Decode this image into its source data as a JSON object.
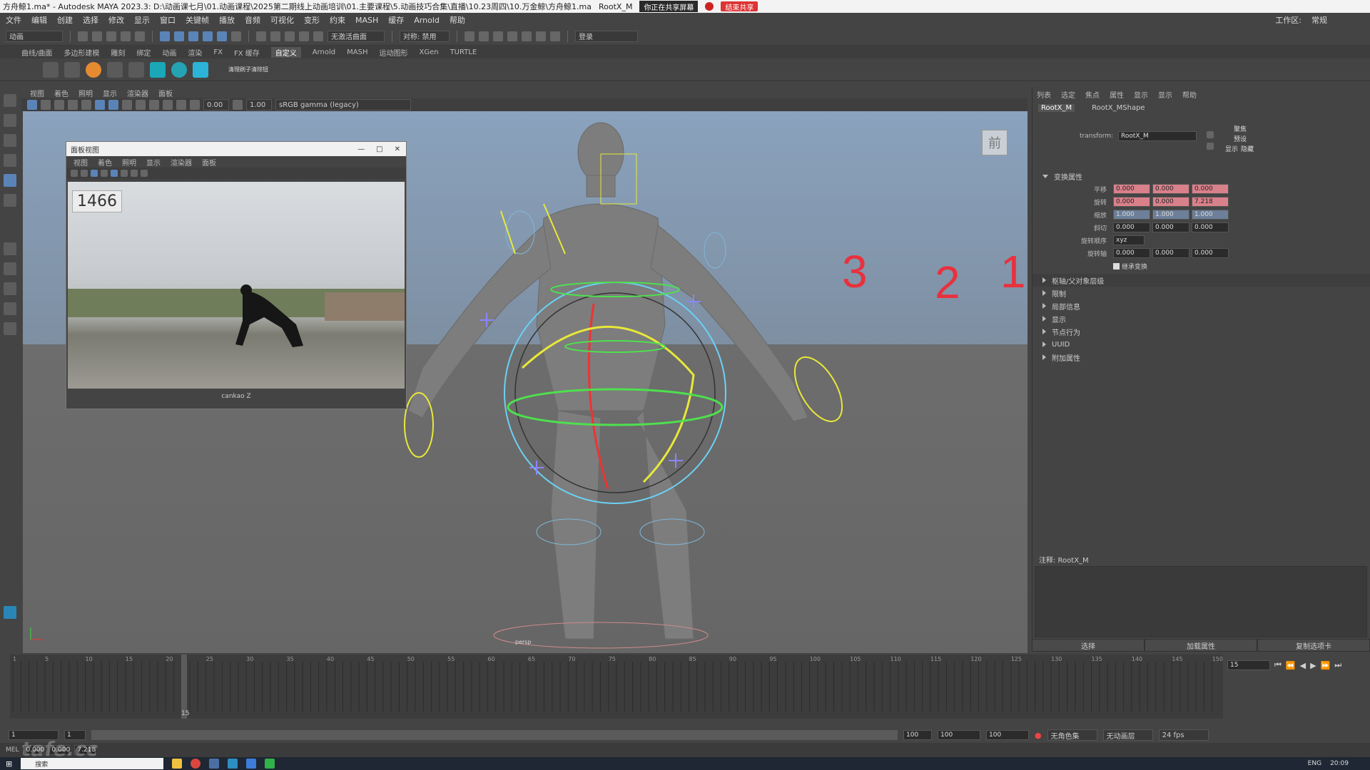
{
  "titlebar": {
    "title": "方舟鲸1.ma* - Autodesk MAYA 2023.3: D:\\动画课七月\\01.动画课程\\2025第二期线上动画培训\\01.主要课程\\5.动画技巧合集\\直播\\10.23周四\\10.万金鲸\\方舟鲸1.ma",
    "node": "RootX_M",
    "share_status": "你正在共享屏幕",
    "stop_share": "结束共享"
  },
  "menubar": {
    "items": [
      "文件",
      "编辑",
      "创建",
      "选择",
      "修改",
      "显示",
      "窗口",
      "关键帧",
      "播放",
      "音频",
      "可视化",
      "变形",
      "约束",
      "MASH",
      "缓存",
      "Arnold",
      "帮助"
    ],
    "workspace_label": "工作区:",
    "workspace_value": "常规"
  },
  "statusline": {
    "mode": "动画",
    "no_live_surface": "无激活曲面",
    "symmetry": "对称: 禁用",
    "login": "登录"
  },
  "shelf": {
    "tabs": [
      "曲线/曲面",
      "多边形建模",
      "雕刻",
      "绑定",
      "动画",
      "渲染",
      "FX",
      "FX 缓存",
      "自定义",
      "Arnold",
      "MASH",
      "运动图形",
      "XGen",
      "TURTLE"
    ],
    "active_tab": "自定义",
    "extra_label": "清理刷子清除钮"
  },
  "viewport": {
    "menu": [
      "视图",
      "着色",
      "照明",
      "显示",
      "渲染器",
      "面板"
    ],
    "exposure": "0.00",
    "gamma": "1.00",
    "color_space": "sRGB gamma (legacy)",
    "viewcube_label": "前",
    "camera": "persp",
    "grease_marks": [
      "3",
      "2",
      "1"
    ]
  },
  "reference_window": {
    "title": "面板视图",
    "menu": [
      "视图",
      "着色",
      "照明",
      "显示",
      "渲染器",
      "面板"
    ],
    "frame_number": "1466",
    "caption": "cankao Z"
  },
  "attribute_editor": {
    "tabs": [
      "列表",
      "选定",
      "焦点",
      "属性",
      "显示",
      "显示",
      "帮助"
    ],
    "nodes": [
      "RootX_M",
      "RootX_MShape"
    ],
    "transform_label": "transform:",
    "transform_value": "RootX_M",
    "focus_btn": "聚焦",
    "preset_btn": "预设",
    "show_btn": "显示",
    "hide_btn": "隐藏",
    "transform_section": "变换属性",
    "rows": [
      {
        "label": "平移",
        "values": [
          "0.000",
          "0.000",
          "0.000"
        ],
        "style": "red"
      },
      {
        "label": "旋转",
        "values": [
          "0.000",
          "0.000",
          "7.218"
        ],
        "style": "red"
      },
      {
        "label": "缩放",
        "values": [
          "1.000",
          "1.000",
          "1.000"
        ],
        "style": "blue"
      },
      {
        "label": "斜切",
        "values": [
          "0.000",
          "0.000",
          "0.000"
        ],
        "style": "plain"
      }
    ],
    "rotate_order_label": "旋转顺序",
    "rotate_order_value": "xyz",
    "rotate_axis_label": "旋转轴",
    "rotate_axis_values": [
      "0.000",
      "0.000",
      "0.000"
    ],
    "inherits_label": "继承变换",
    "sections": [
      "枢轴/父对象层级",
      "限制",
      "局部信息",
      "显示",
      "节点行为",
      "UUID",
      "附加属性"
    ],
    "notes_label": "注释: RootX_M",
    "bottom_buttons": [
      "选择",
      "加载属性",
      "复制选项卡"
    ]
  },
  "timeline": {
    "current_frame": "15",
    "frame_field": "15",
    "ticks": [
      "1",
      "5",
      "10",
      "15",
      "20",
      "25",
      "30",
      "35",
      "40",
      "45",
      "50",
      "55",
      "60",
      "65",
      "70",
      "75",
      "80",
      "85",
      "90",
      "95",
      "100",
      "105",
      "110",
      "115",
      "120",
      "125",
      "130",
      "135",
      "140",
      "145",
      "150"
    ]
  },
  "range": {
    "start": "1",
    "start2": "1",
    "end_a": "100",
    "end_b": "100",
    "end_c": "100",
    "charset": "无角色集",
    "anim_layer": "无动画层",
    "fps": "24 fps"
  },
  "cmdline": {
    "label": "MEL",
    "values": [
      "0.000",
      "0.000",
      "7.218"
    ]
  },
  "taskbar": {
    "search": "搜索",
    "time": "20:09",
    "lang": "ENG"
  },
  "watermark": "tafe.cc"
}
